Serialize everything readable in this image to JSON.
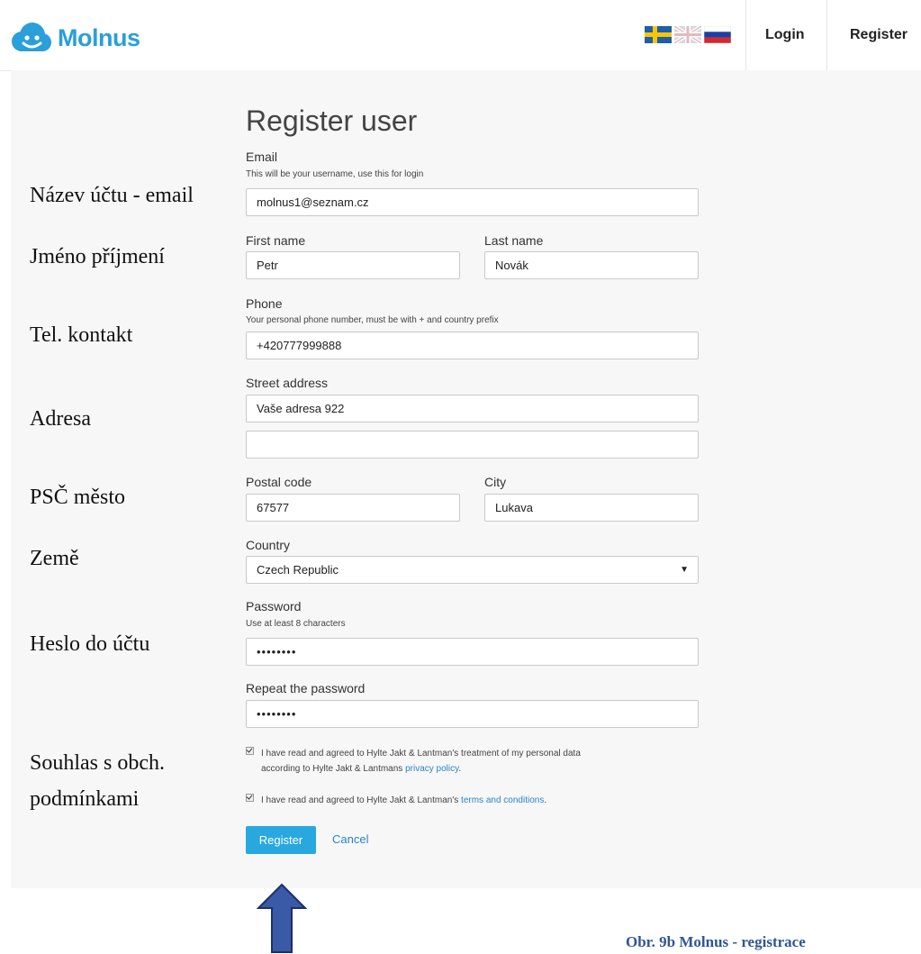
{
  "header": {
    "brand": "Molnus",
    "logo_icon": "smiling-cloud",
    "flags": [
      "sweden-flag",
      "uk-flag",
      "russia-flag"
    ],
    "login_label": "Login",
    "register_label": "Register"
  },
  "form": {
    "title": "Register user",
    "email": {
      "label": "Email",
      "help": "This will be your username, use this for login",
      "value": "molnus1@seznam.cz"
    },
    "first_name": {
      "label": "First name",
      "value": "Petr"
    },
    "last_name": {
      "label": "Last name",
      "value": "Novák"
    },
    "phone": {
      "label": "Phone",
      "help": "Your personal phone number, must be with + and country prefix",
      "value": "+420777999888"
    },
    "street": {
      "label": "Street address",
      "value": "Vaše adresa 922",
      "value2": ""
    },
    "postal_code": {
      "label": "Postal code",
      "value": "67577"
    },
    "city": {
      "label": "City",
      "value": "Lukava"
    },
    "country": {
      "label": "Country",
      "value": "Czech Republic"
    },
    "password": {
      "label": "Password",
      "help": "Use at least 8 characters",
      "value": "••••••••"
    },
    "repeat_password": {
      "label": "Repeat the password",
      "value": "••••••••"
    },
    "consent_privacy": {
      "text": "I have read and agreed to Hylte Jakt & Lantman's treatment of my personal data",
      "text2": "according to Hylte Jakt & Lantmans ",
      "link": "privacy policy",
      "suffix": ".",
      "checked": true
    },
    "consent_terms": {
      "text": "I have read and agreed to Hylte Jakt & Lantman's ",
      "link": "terms and conditions",
      "suffix": ".",
      "checked": true
    },
    "register_button": "Register",
    "cancel_link": "Cancel"
  },
  "annotations": {
    "email": "Název účtu - email",
    "name": "Jméno příjmení",
    "phone": "Tel. kontakt",
    "address": "Adresa",
    "postal": "PSČ město",
    "country": "Země",
    "password": "Heslo do účtu",
    "consent_line1": "Souhlas s obch.",
    "consent_line2": "podmínkami"
  },
  "caption": "Obr. 9b Molnus - registrace",
  "colors": {
    "brand": "#2a9fd9",
    "button": "#29a8e0",
    "link": "#2a85c4",
    "arrow": "#3a5aa8",
    "caption": "#2f5597"
  }
}
